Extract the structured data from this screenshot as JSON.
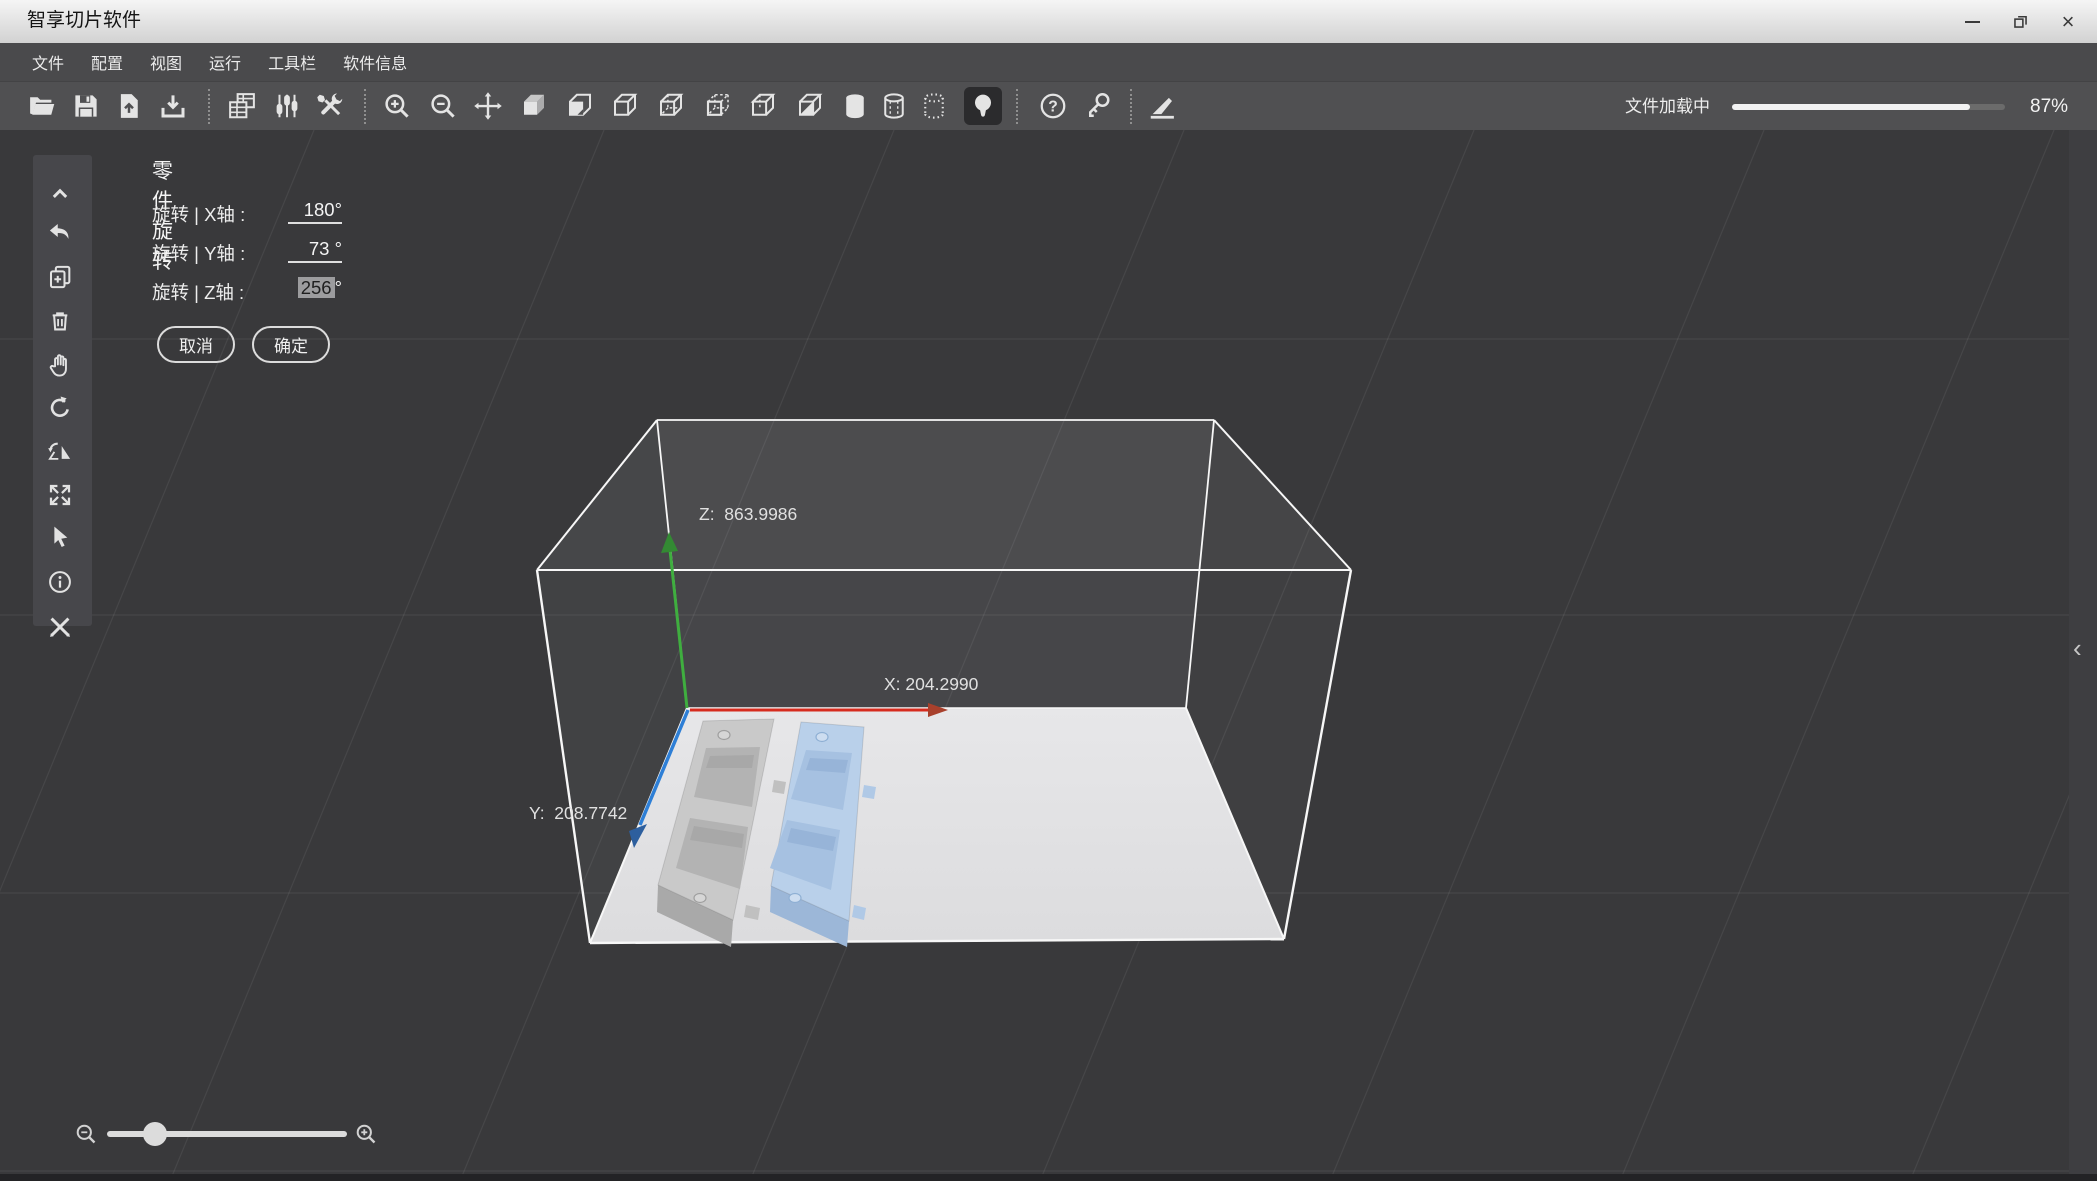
{
  "window": {
    "title": "智享切片软件"
  },
  "window_controls": {
    "minimize": "minimize",
    "restore": "restore",
    "close": "×"
  },
  "menu": {
    "items": [
      "文件",
      "配置",
      "视图",
      "运行",
      "工具栏",
      "软件信息"
    ]
  },
  "toolbar": {
    "items": [
      "open-folder",
      "save",
      "import-file",
      "export-tray",
      "sep",
      "batch-copy",
      "sliders",
      "tools",
      "sep",
      "zoom-in",
      "zoom-out",
      "move",
      "cube-solid",
      "cube-page",
      "cube-wire",
      "cube-dash",
      "cube-hidden",
      "cube-open",
      "cube-half",
      "cylinder-solid",
      "cylinder-wire",
      "cylinder-dots",
      "bulb",
      "sep",
      "help",
      "key",
      "sep",
      "blade"
    ],
    "active_item": "bulb"
  },
  "progress": {
    "label": "文件加载中",
    "value": 87,
    "percent_text": "87%"
  },
  "side_toolbar": {
    "items": [
      "chevron-up",
      "undo",
      "add-copy",
      "delete",
      "pan-hand",
      "rotate-ccw",
      "mirror",
      "expand",
      "cursor",
      "info",
      "cross-tools"
    ]
  },
  "rotation_panel": {
    "title": "零件旋转",
    "rows": [
      {
        "label": "旋转 | X轴 :",
        "value": "180",
        "unit": "°",
        "selected": false
      },
      {
        "label": "旋转 | Y轴 :",
        "value": "73",
        "unit": "°",
        "selected": false
      },
      {
        "label": "旋转 | Z轴 :",
        "value": "256",
        "unit": "°",
        "selected": true
      }
    ],
    "cancel_label": "取消",
    "confirm_label": "确定"
  },
  "viewport": {
    "axes": {
      "x": {
        "label": "X: 204.2990",
        "color": "#d62b1e"
      },
      "y": {
        "label": "Y:  208.7742",
        "color": "#2e7fd6"
      },
      "z": {
        "label": "Z:  863.9986",
        "color": "#3fae3f"
      }
    },
    "build_plate_color": "#e2e2e4",
    "models": [
      {
        "name": "model-gray",
        "color": "#c9c9c9"
      },
      {
        "name": "model-blue",
        "color": "#b9d0ea"
      }
    ]
  },
  "zoom_control": {
    "position_pct": 20
  },
  "right_toggle": {
    "chevron": "‹"
  }
}
